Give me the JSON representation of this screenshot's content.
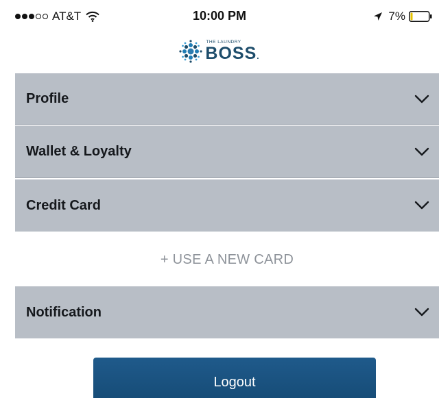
{
  "status_bar": {
    "carrier": "AT&T",
    "time": "10:00 PM",
    "battery": "7%"
  },
  "header": {
    "logo_top": "THE LAUNDRY",
    "logo_main": "BOSS",
    "logo_mark": ".",
    "brand_color": "#1e4d6b"
  },
  "menu": {
    "items": [
      {
        "label": "Profile"
      },
      {
        "label": "Wallet & Loyalty"
      },
      {
        "label": "Credit Card"
      },
      {
        "label": "Notification"
      }
    ],
    "use_new_card": "+ USE A NEW CARD"
  },
  "logout": {
    "label": "Logout",
    "color": "#1b5180"
  },
  "colors": {
    "row_background": "#b8bec6",
    "muted_text": "#8e939a"
  },
  "icons": [
    "wifi-icon",
    "location-arrow-icon",
    "battery-icon",
    "laundry-boss-logo-icon",
    "chevron-down-icon"
  ]
}
